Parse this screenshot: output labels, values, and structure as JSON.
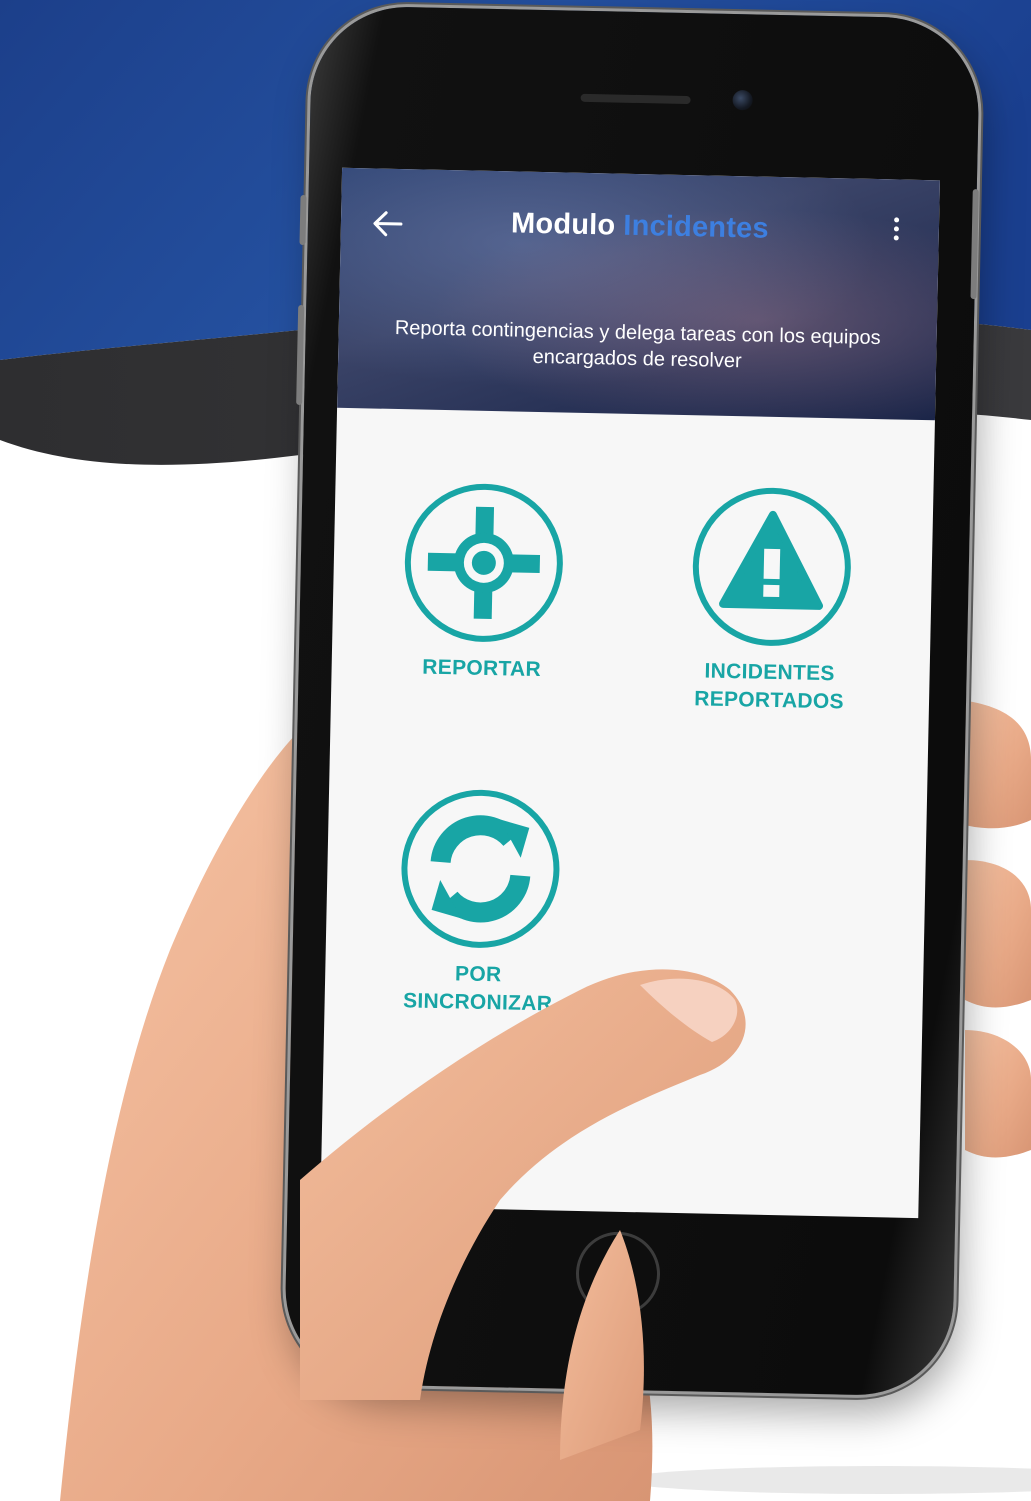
{
  "app": {
    "title_prefix": "Modulo",
    "title_accent": "Incidentes",
    "subtitle": "Reporta contingencias y delega tareas con los equipos encargados de resolver"
  },
  "tiles": [
    {
      "label_line1": "REPORTAR",
      "label_line2": "",
      "icon": "crosshair-icon"
    },
    {
      "label_line1": "INCIDENTES",
      "label_line2": "REPORTADOS",
      "icon": "warning-triangle-icon"
    },
    {
      "label_line1": "POR",
      "label_line2": "SINCRONIZAR",
      "icon": "sync-icon"
    }
  ],
  "colors": {
    "accent_teal": "#18a5a5",
    "title_accent_blue": "#3d7fe0",
    "header_bg": "#2d4271",
    "background_blue": "#1f4a9c"
  }
}
